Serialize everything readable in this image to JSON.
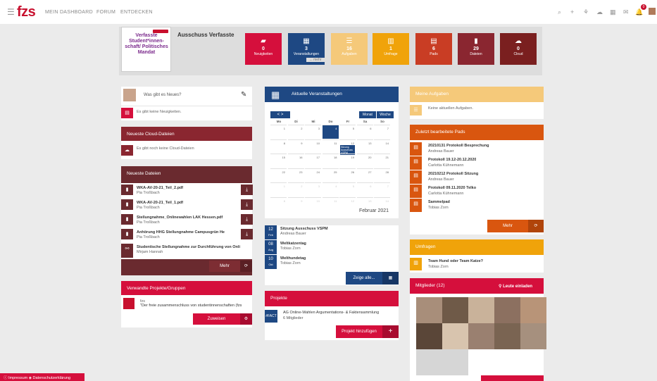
{
  "topbar": {
    "menu_icon": "hamburger-icon",
    "logo": "fzs",
    "nav": [
      "MEIN DASHBOARD",
      "FORUM",
      "ENTDECKEN"
    ],
    "icons": [
      "search-icon",
      "plus-icon",
      "network-icon",
      "cloud-icon",
      "calendar-icon",
      "mail-icon",
      "bell-icon",
      "avatar"
    ],
    "notif_count": "0",
    "accent": "#c8102e"
  },
  "space": {
    "logo_text": "Verfasste Student*innen-schaft/ Politisches Mandat",
    "title": "Ausschuss Verfasste",
    "tiles": [
      {
        "icon": "book-icon",
        "count": "0",
        "label": "Neuigkeiten",
        "color": "#d50f3c"
      },
      {
        "icon": "calendar-icon",
        "count": "3",
        "label": "Veranstaltungen",
        "color": "#1e4883",
        "extra": "... mehr"
      },
      {
        "icon": "tasks-icon",
        "count": "16",
        "label": "Aufgaben",
        "color": "#f5c97a"
      },
      {
        "icon": "chart-icon",
        "count": "1",
        "label": "Umfrage",
        "color": "#f0a30a"
      },
      {
        "icon": "pad-icon",
        "count": "6",
        "label": "Pads",
        "color": "#c93d24"
      },
      {
        "icon": "file-icon",
        "count": "29",
        "label": "Dateien",
        "color": "#8a2630"
      },
      {
        "icon": "cloud-icon",
        "count": "0",
        "label": "Cloud",
        "color": "#7a1f1f"
      }
    ]
  },
  "news": {
    "placeholder": "Was gibt es Neues?",
    "empty": "Es gibt keine Neuigkeiten."
  },
  "cloud": {
    "title": "Neueste Cloud-Dateien",
    "empty": "Es gibt noch keine Cloud-Dateien"
  },
  "files": {
    "title": "Neueste Dateien",
    "items": [
      {
        "name": "WKA-AV-20-21_Teil_2.pdf",
        "user": "Pia Troßbach"
      },
      {
        "name": "WKA-AV-20-21_Teil_1.pdf",
        "user": "Pia Troßbach"
      },
      {
        "name": "Stellungnahme_Onlinewahlen LAK Hessen.pdf",
        "user": "Pia Troßbach"
      },
      {
        "name": "Anhörung HHG Stellungnahme Campusgrün He",
        "user": "Pia Troßbach"
      },
      {
        "name": "Studentische Stellungnahme zur Durchführung von Onli",
        "user": "Mirjam Hannah"
      }
    ],
    "more": "Mehr"
  },
  "related": {
    "title": "Verwandte Projekte/Gruppen",
    "name": "fzs",
    "desc": "\"Der freie zusammenschluss von studentinnenschaften (fzs",
    "assign": "Zuweisen"
  },
  "events": {
    "title": "Aktuelle Veranstaltungen",
    "month_btn": "Monat",
    "week_btn": "Woche",
    "month_label": "Februar 2021",
    "weekdays": [
      "Mo",
      "Di",
      "Mi",
      "Do",
      "Fr",
      "Sa",
      "So"
    ],
    "weeks": [
      [
        "1",
        "2",
        "3",
        "4",
        "5",
        "6",
        "7"
      ],
      [
        "8",
        "9",
        "10",
        "11",
        "12",
        "13",
        "14"
      ],
      [
        "15",
        "16",
        "17",
        "18",
        "19",
        "20",
        "21"
      ],
      [
        "22",
        "23",
        "24",
        "25",
        "26",
        "27",
        "28"
      ],
      [
        "1",
        "2",
        "3",
        "4",
        "5",
        "6",
        "7"
      ],
      [
        "8",
        "9",
        "10",
        "11",
        "12",
        "13",
        "14"
      ]
    ],
    "event_in_cal": "Sitzung Ausschuss VSPM",
    "list": [
      {
        "day": "12",
        "mon": "Feb",
        "title": "Sitzung Ausschuss VSPM",
        "user": "Andreas Bauer"
      },
      {
        "day": "08",
        "mon": "Aug",
        "title": "Weltkatzentag",
        "user": "Tobias Zorn"
      },
      {
        "day": "10",
        "mon": "Okt",
        "title": "Welthundetag",
        "user": "Tobias Zorn"
      }
    ],
    "show_all": "Zeige alle..."
  },
  "projects": {
    "title": "Projekte",
    "name": "AG Online-Wahlen Argumentations- & Faktensammlung",
    "members": "6 Mitglieder",
    "badge": "#FACT",
    "add": "Projekt hinzufügen"
  },
  "tasks": {
    "title": "Meine Aufgaben",
    "empty": "Keine aktuellen Aufgaben."
  },
  "pads": {
    "title": "Zuletzt bearbeitete Pads",
    "items": [
      {
        "name": "20210131 Protokoll Besprechung",
        "user": "Andreas Bauer"
      },
      {
        "name": "Protokoll 19.12-20.12.2020",
        "user": "Carlotta Kühnemann"
      },
      {
        "name": "20210212 Protokoll Sitzung",
        "user": "Andreas Bauer"
      },
      {
        "name": "Protokoll 09.11.2020 Telko",
        "user": "Carlotta Kühnemann"
      },
      {
        "name": "Sammelpad",
        "user": "Tobias Zorn"
      }
    ],
    "more": "Mehr"
  },
  "polls": {
    "title": "Umfragen",
    "name": "Team Hund oder Team Katze?",
    "user": "Tobias Zorn"
  },
  "members": {
    "title": "Mitglieder (12)",
    "invite": "Leute einladen"
  },
  "footer": {
    "imprint": "Impressum",
    "privacy": "Datenschutzerklärung"
  }
}
